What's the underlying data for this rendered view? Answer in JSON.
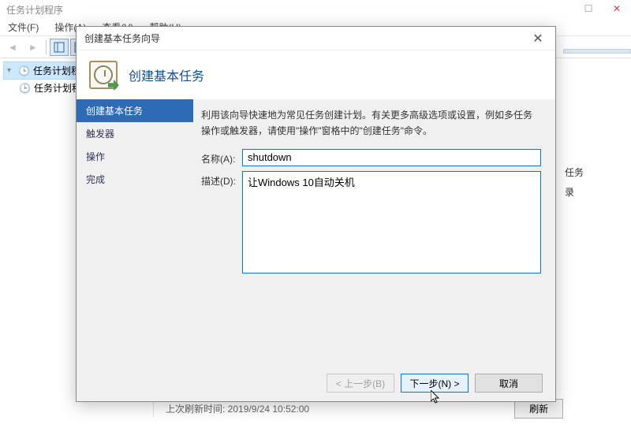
{
  "main_window": {
    "title": "任务计划程序",
    "menu": {
      "file": "文件(F)",
      "action": "操作(A)",
      "view": "查看(V)",
      "help": "帮助(H)"
    },
    "tree": {
      "root": "任务计划程序 (本地",
      "child": "任务计划程序库"
    },
    "right_panel": {
      "item1": "任务",
      "item2": "录"
    },
    "status": "上次刷新时间: 2019/9/24 10:52:00",
    "refresh": "刷新"
  },
  "dialog": {
    "title": "创建基本任务向导",
    "header": "创建基本任务",
    "steps": {
      "s1": "创建基本任务",
      "s2": "触发器",
      "s3": "操作",
      "s4": "完成"
    },
    "intro": "利用该向导快速地为常见任务创建计划。有关更多高级选项或设置，例如多任务操作或触发器，请使用\"操作\"窗格中的\"创建任务\"命令。",
    "labels": {
      "name": "名称(A):",
      "desc": "描述(D):"
    },
    "values": {
      "name": "shutdown",
      "desc": "让Windows 10自动关机"
    },
    "buttons": {
      "back": "< 上一步(B)",
      "next": "下一步(N) >",
      "cancel": "取消"
    }
  },
  "icons": {
    "back": "⮜",
    "forward": "⮞"
  }
}
